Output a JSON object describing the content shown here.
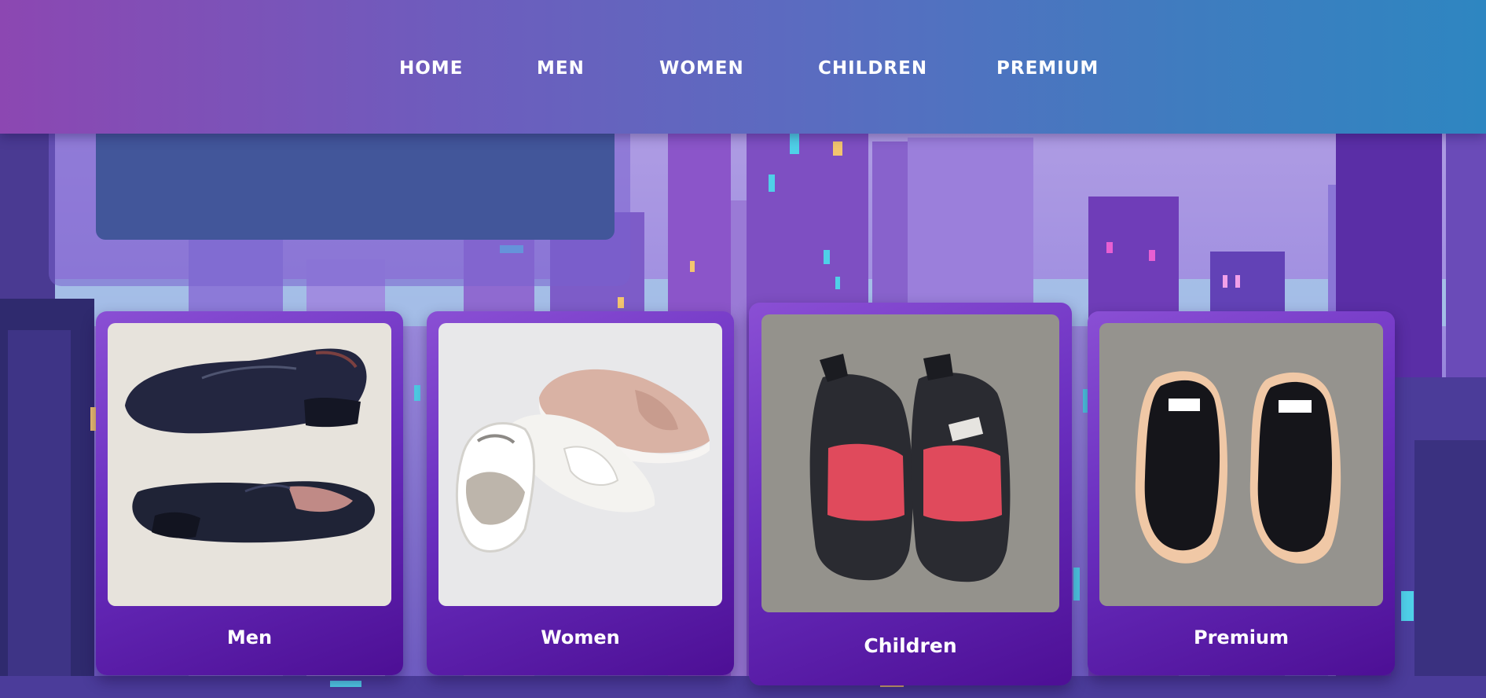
{
  "nav": {
    "items": [
      {
        "label": "HOME"
      },
      {
        "label": "MEN"
      },
      {
        "label": "WOMEN"
      },
      {
        "label": "CHILDREN"
      },
      {
        "label": "PREMIUM"
      }
    ]
  },
  "categories": [
    {
      "title": "Men",
      "image": "black-leather-oxford-shoes"
    },
    {
      "title": "Women",
      "image": "bow-slip-on-sneakers"
    },
    {
      "title": "Children",
      "image": "black-red-kids-loafers"
    },
    {
      "title": "Premium",
      "image": "black-peach-sneakers"
    }
  ],
  "colors": {
    "nav_gradient_start": "#8c47b2",
    "nav_gradient_end": "#2e86c1",
    "card_gradient_start": "#8a4fd4",
    "card_gradient_end": "#4d0f95",
    "hero_panel": "#42569a",
    "text": "#ffffff"
  }
}
